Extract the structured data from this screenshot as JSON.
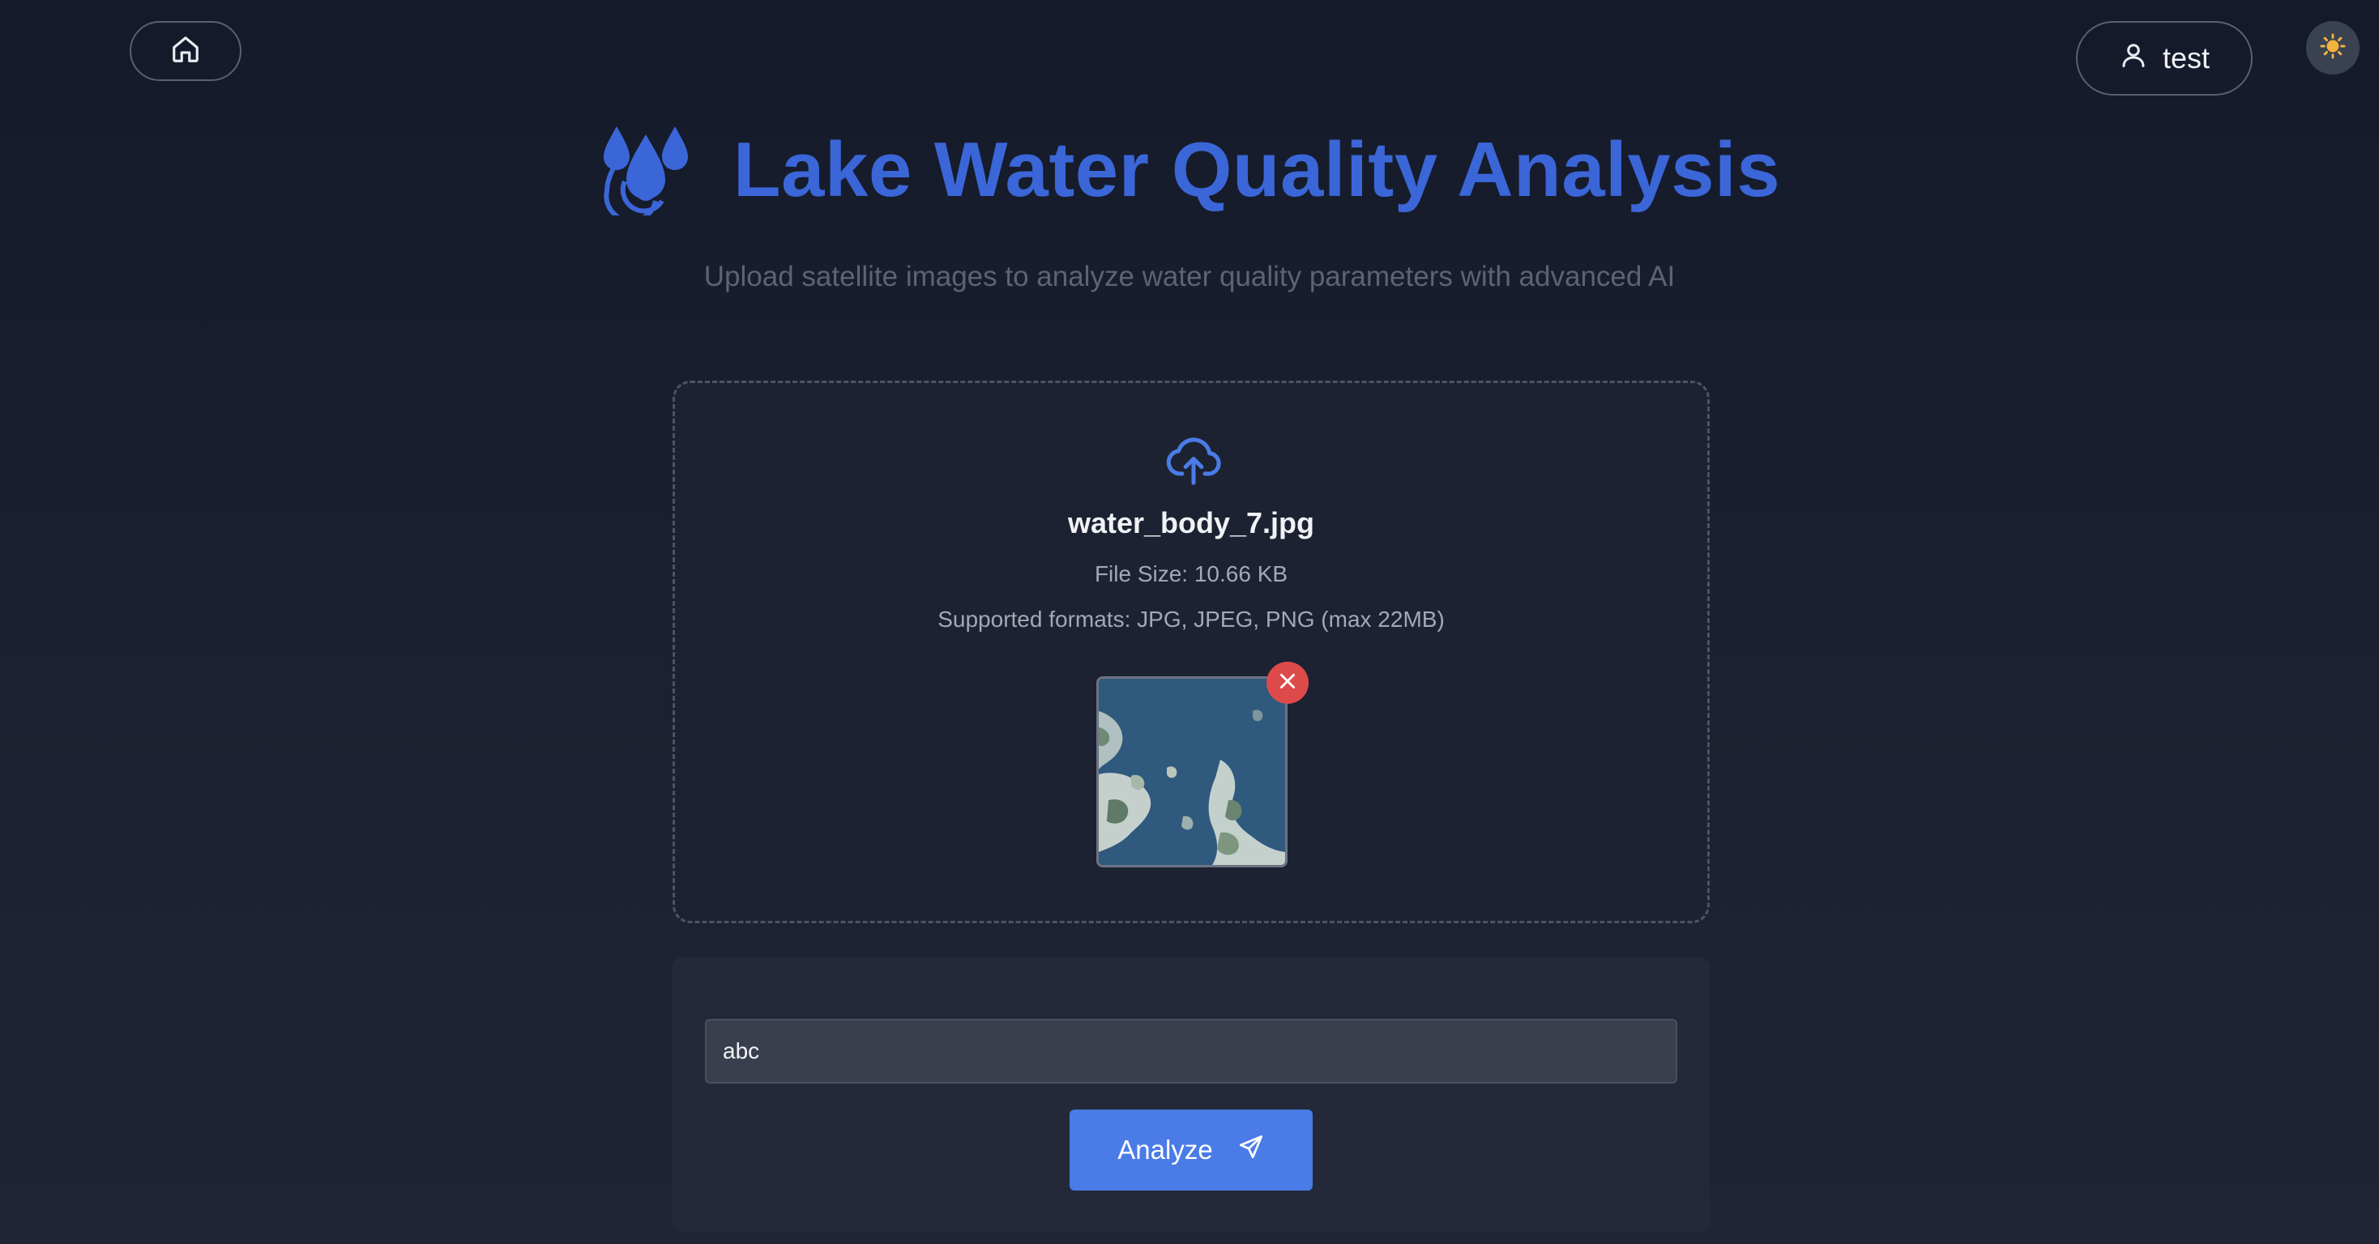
{
  "header": {
    "user_label": "test",
    "icons": {
      "home": "home-icon",
      "user": "user-icon",
      "theme": "sun-icon"
    }
  },
  "hero": {
    "title": "Lake Water Quality Analysis",
    "subtitle": "Upload satellite images to analyze water quality parameters with advanced AI",
    "logo_icon": "water-drops-icon"
  },
  "upload": {
    "file_name": "water_body_7.jpg",
    "file_size": "File Size: 10.66 KB",
    "formats": "Supported formats: JPG, JPEG, PNG (max 22MB)",
    "icon": "cloud-upload-icon",
    "remove_icon": "close-icon"
  },
  "prompt": {
    "value": "abc"
  },
  "analyze": {
    "label": "Analyze",
    "icon": "send-icon"
  },
  "colors": {
    "accent": "#3b66d8",
    "button": "#4a7be6",
    "danger": "#dd4a4a",
    "background": "#1b2130"
  }
}
